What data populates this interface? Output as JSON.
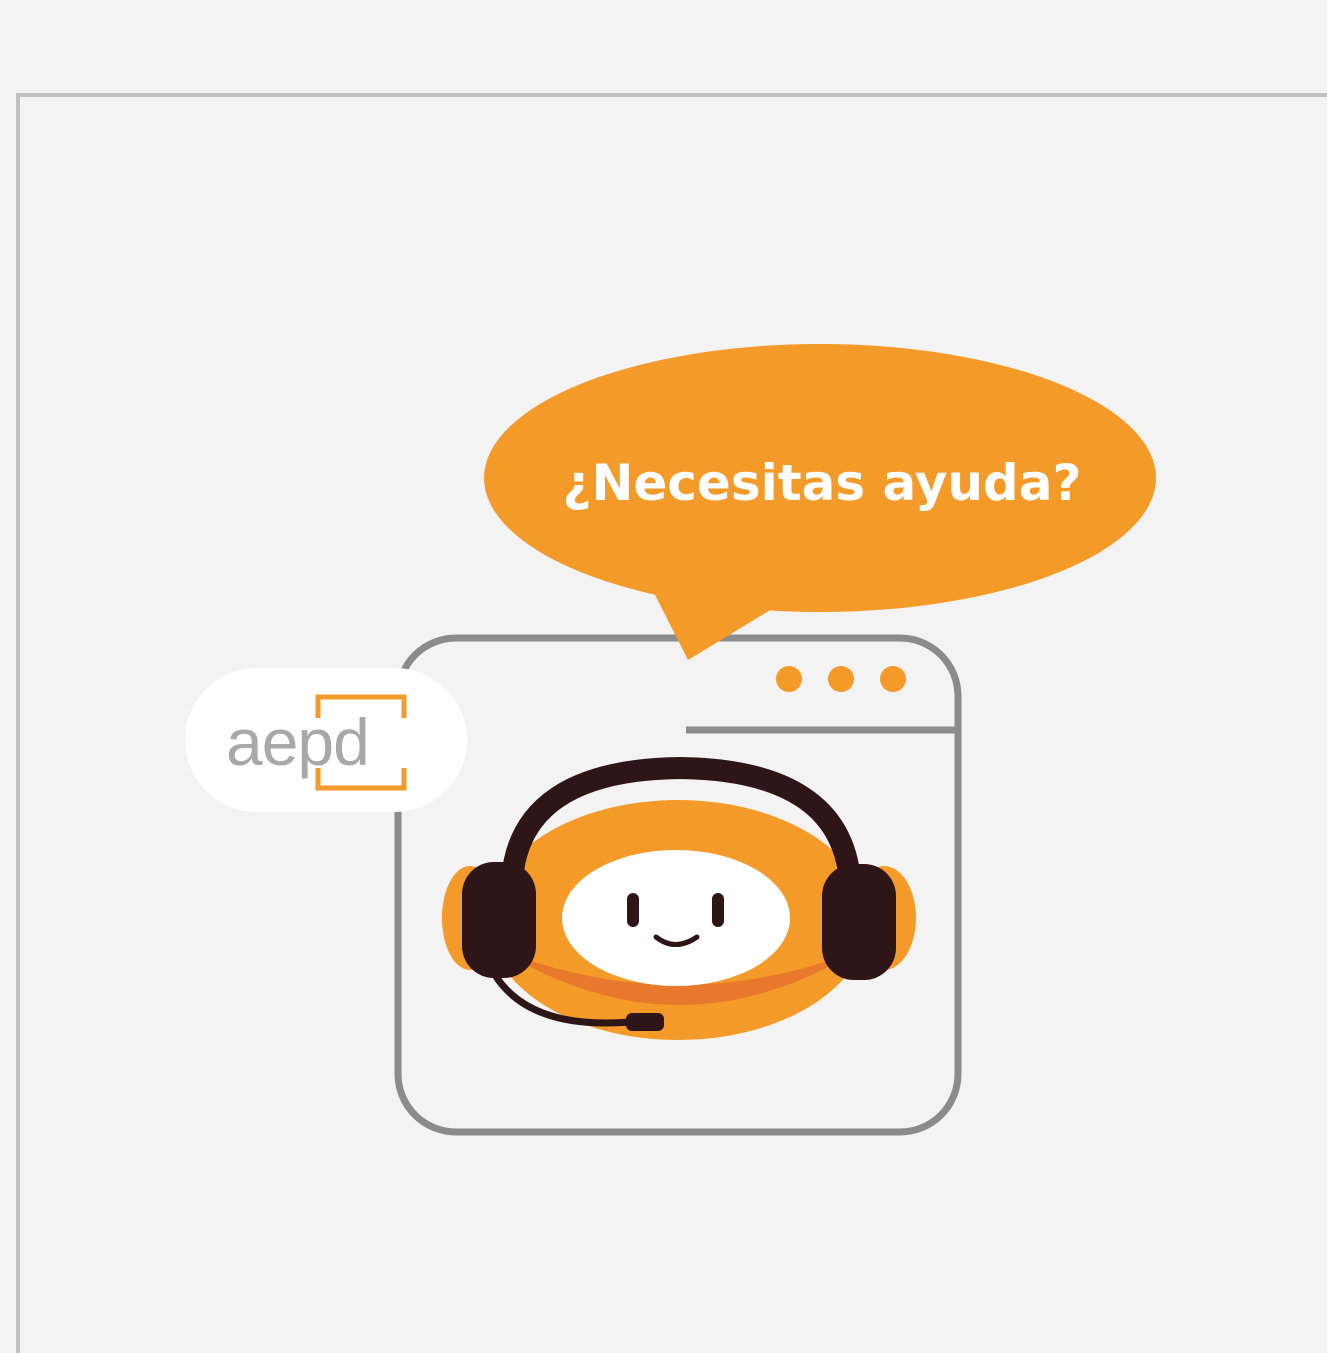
{
  "speech_bubble": {
    "text": "¿Necesitas ayuda?"
  },
  "logo": {
    "text": "aepd"
  },
  "icons": {
    "window": "browser-window-icon",
    "window_dots": "window-dots-icon",
    "mascot": "support-agent-mascot-icon",
    "headset": "headset-icon"
  },
  "colors": {
    "brand_orange": "#f39a28",
    "window_gray": "#8b8b8b",
    "headset_brown": "#2e1517",
    "background": "#f3f3f3",
    "frame_gray": "#c2c2c2",
    "logo_gray": "#a8a8a8"
  }
}
